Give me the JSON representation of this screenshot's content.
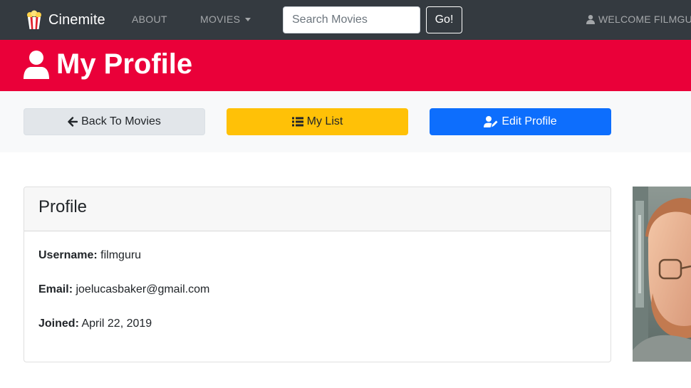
{
  "navbar": {
    "brand": "Cinemite",
    "about": "ABOUT",
    "movies": "MOVIES",
    "search_placeholder": "Search Movies",
    "search_button": "Go!",
    "welcome": "WELCOME FILMGURU"
  },
  "header": {
    "title": "My Profile"
  },
  "actions": {
    "back": "Back To Movies",
    "my_list": "My List",
    "edit_profile": "Edit Profile"
  },
  "profile": {
    "card_title": "Profile",
    "username_label": "Username:",
    "username": "filmguru",
    "email_label": "Email:",
    "email": "joelucasbaker@gmail.com",
    "joined_label": "Joined:",
    "joined": "April 22, 2019"
  },
  "colors": {
    "navbar": "#343a40",
    "header": "#ea0039",
    "action_bar": "#f8f9fa",
    "btn_back": "#e2e6ea",
    "btn_list": "#ffc107",
    "btn_edit": "#0d6efd"
  },
  "icons": {
    "brand": "popcorn-icon",
    "welcome": "user-icon",
    "title": "user-icon",
    "back": "arrow-left-icon",
    "list": "list-icon",
    "edit": "user-edit-icon"
  }
}
